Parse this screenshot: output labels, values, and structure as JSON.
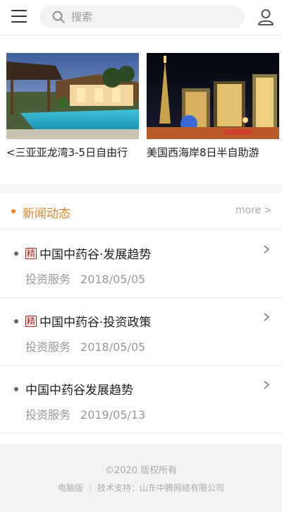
{
  "header": {
    "search_placeholder": "搜索"
  },
  "banner": {
    "cards": [
      {
        "title": "<三亚亚龙湾3-5日自由行"
      },
      {
        "title": "美国西海岸8日半自助游"
      }
    ]
  },
  "news": {
    "section_title": "新闻动态",
    "more_label": "more",
    "items": [
      {
        "tag": "精",
        "title": "中国中药谷·发展趋势",
        "category": "投资服务",
        "date": "2018/05/05"
      },
      {
        "tag": "精",
        "title": "中国中药谷·投资政策",
        "category": "投资服务",
        "date": "2018/05/05"
      },
      {
        "tag": "",
        "title": "中国中药谷发展趋势",
        "category": "投资服务",
        "date": "2019/05/13"
      }
    ]
  },
  "footer": {
    "copyright": "©2020 版权所有",
    "desktop_link": "电脑版",
    "separator": "|",
    "support": "技术支持：山东中腾网络有限公司"
  },
  "colors": {
    "accent": "#e0862b",
    "tag_red": "#b32222"
  }
}
